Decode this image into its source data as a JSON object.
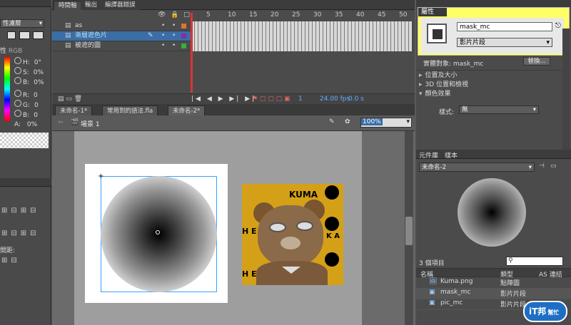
{
  "timeline": {
    "tabs": [
      "時間軸",
      "輸出",
      "編譯器錯誤"
    ],
    "frame_numbers": [
      "5",
      "10",
      "15",
      "20",
      "25",
      "30",
      "35",
      "40",
      "45",
      "50"
    ],
    "layers": [
      {
        "name": "as",
        "selected": false
      },
      {
        "name": "漸層遮色片",
        "selected": true
      },
      {
        "name": "被遮的圖",
        "selected": false
      }
    ],
    "status": {
      "frame": "1",
      "fps": "24.00 fps",
      "time": "0.0 s"
    }
  },
  "doc_tabs": [
    "未命名-1*",
    "常用到的語法.fla",
    "未命名-2*"
  ],
  "edit_bar": {
    "scene": "場景 1",
    "zoom": "100%"
  },
  "left_panel": {
    "blend_label": "性濾層",
    "color_mode": "RGB",
    "color_prefix": "性",
    "hsb": [
      {
        "k": "H:",
        "v": "0",
        "u": "°"
      },
      {
        "k": "S:",
        "v": "0",
        "u": "%"
      },
      {
        "k": "B:",
        "v": "0",
        "u": "%"
      }
    ],
    "rgb": [
      {
        "k": "R:",
        "v": "0"
      },
      {
        "k": "G:",
        "v": "0"
      },
      {
        "k": "B:",
        "v": "0"
      }
    ],
    "alpha": {
      "k": "A:",
      "v": "0",
      "u": "%"
    },
    "spacing_label": "間距:"
  },
  "properties": {
    "tabs": [
      "屬性"
    ],
    "instance_name": "mask_mc",
    "instance_type": "影片片段",
    "entity_label": "實體對象: mask_mc",
    "swap_button": "替換...",
    "sections": [
      "位置及大小",
      "3D 位置和檢視",
      "顏色效果"
    ],
    "style_label": "樣式:",
    "style_value": "無"
  },
  "library": {
    "tabs": [
      "元件庫",
      "樣本"
    ],
    "doc_select": "未命名-2",
    "count": "3 個項目",
    "columns": [
      "名稱",
      "類型",
      "AS 連結"
    ],
    "items": [
      {
        "name": "Kuma.png",
        "type": "點陣圖",
        "icon": "bitmap-icon"
      },
      {
        "name": "mask_mc",
        "type": "影片片段",
        "icon": "movieclip-icon"
      },
      {
        "name": "pic_mc",
        "type": "影片片段",
        "icon": "movieclip-icon"
      }
    ]
  },
  "stage": {
    "kuma_text": "KUMA",
    "kuma_side": "H E",
    "kuma_side2": "K A"
  },
  "watermark": {
    "brand": "iT邦",
    "sub": "幫忙"
  },
  "colors": {
    "highlight": "#ffff66",
    "selection": "#3a6ea5",
    "bear_bg": "#d4a017"
  }
}
